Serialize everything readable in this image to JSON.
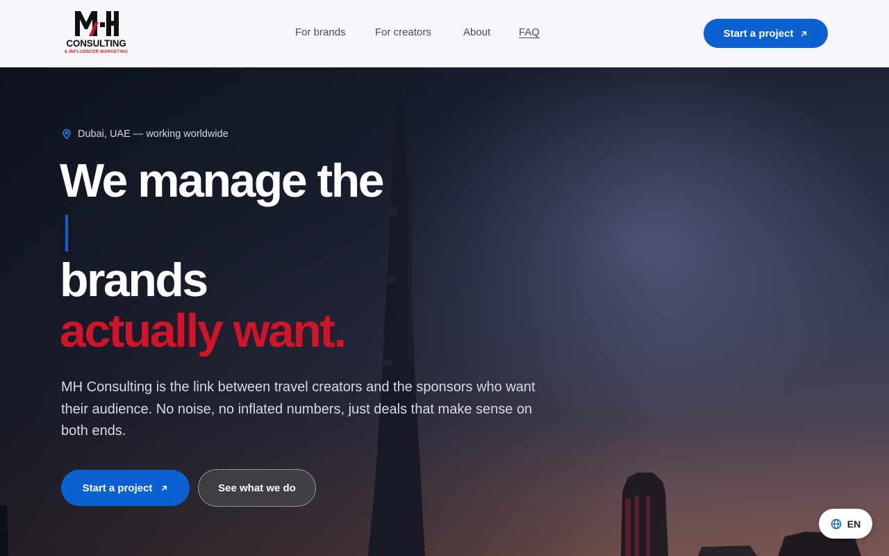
{
  "brand": {
    "logo_letters": "MH",
    "logo_word": "CONSULTING",
    "logo_sub": "& INFLUENCER MARKETING"
  },
  "nav": {
    "items": [
      {
        "label": "For brands"
      },
      {
        "label": "For creators"
      },
      {
        "label": "About"
      },
      {
        "label": "FAQ"
      }
    ]
  },
  "header": {
    "cta_label": "Start a project"
  },
  "hero": {
    "location": "Dubai, UAE — working worldwide",
    "headline_line1": "We manage the",
    "headline_line2": "brands",
    "headline_accent": "actually want.",
    "lede": "MH Consulting is the link between travel creators and the sponsors who want their audience. No noise, no inflated numbers, just deals that make sense on both ends.",
    "primary_cta": "Start a project",
    "secondary_cta": "See what we do"
  },
  "language": {
    "current": "EN"
  },
  "colors": {
    "accent_blue": "#0a62d0",
    "accent_red": "#d0142a"
  },
  "icons": {
    "location": "map-pin-icon",
    "arrow": "arrow-up-right-icon",
    "language": "globe-icon"
  }
}
